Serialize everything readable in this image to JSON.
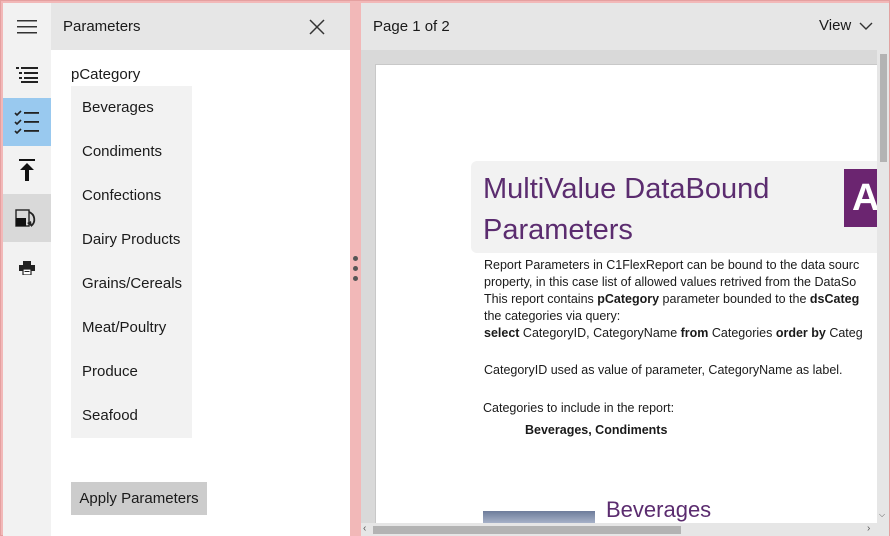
{
  "rail": {
    "buttons": [
      {
        "icon": "hamburger-menu-icon"
      },
      {
        "icon": "outline-list-icon"
      },
      {
        "icon": "parameters-checklist-icon",
        "active": true
      },
      {
        "icon": "export-upload-icon"
      },
      {
        "icon": "page-setup-icon"
      },
      {
        "icon": "print-icon"
      }
    ]
  },
  "panel": {
    "title": "Parameters",
    "close_icon": "close-icon",
    "param_label": "pCategory",
    "items": [
      "Beverages",
      "Condiments",
      "Confections",
      "Dairy Products",
      "Grains/Cereals",
      "Meat/Poultry",
      "Produce",
      "Seafood"
    ],
    "apply_label": "Apply Parameters"
  },
  "viewer": {
    "page_info": "Page 1 of 2",
    "view_label": "View",
    "report": {
      "title": "MultiValue DataBound Parameters",
      "logo_letter": "A",
      "lines": [
        {
          "parts": [
            {
              "t": "Report Parameters in C1FlexReport can be bound to the data sourc"
            }
          ]
        },
        {
          "parts": [
            {
              "t": "property, in this case list of allowed values retrived from the DataSo"
            }
          ]
        },
        {
          "parts": [
            {
              "t": "This report contains "
            },
            {
              "t": "pCategory",
              "b": true
            },
            {
              "t": " parameter bounded to the "
            },
            {
              "t": "dsCateg",
              "b": true
            }
          ]
        },
        {
          "parts": [
            {
              "t": "the categories via query:"
            }
          ]
        },
        {
          "parts": [
            {
              "t": "select",
              "b": true
            },
            {
              "t": " CategoryID, CategoryName "
            },
            {
              "t": "from",
              "b": true
            },
            {
              "t": " Categories "
            },
            {
              "t": "order by",
              "b": true
            },
            {
              "t": " Categ"
            }
          ]
        },
        {
          "parts": [
            {
              "t": ""
            }
          ]
        },
        {
          "parts": [
            {
              "t": "CategoryID used as value of parameter, CategoryName as label."
            }
          ]
        }
      ],
      "categories_label": "Categories to include in the report:",
      "categories_value": "Beverages, Condiments",
      "section_heading": "Beverages"
    }
  },
  "colors": {
    "accent_title": "#5b2c6f",
    "logo_bg": "#6b2570",
    "rail_active": "#99c9ef",
    "frame_border": "#f2b8b8"
  }
}
